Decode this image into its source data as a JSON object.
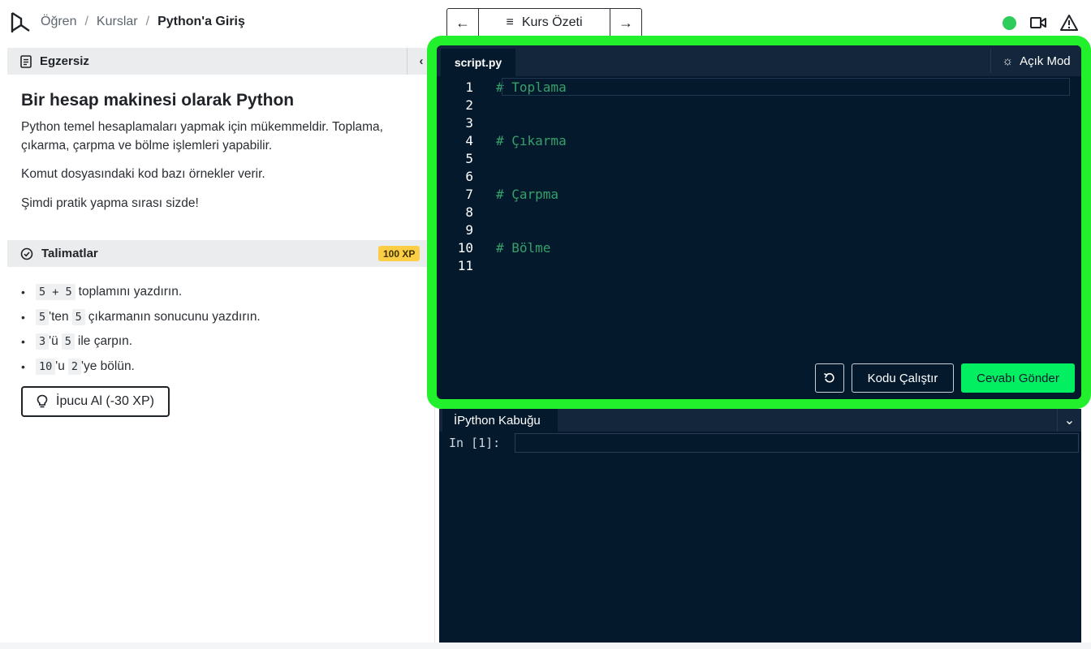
{
  "header": {
    "breadcrumb": [
      "Öğren",
      "Kurslar",
      "Python'a Giriş"
    ],
    "course_nav_label": "Kurs Özeti",
    "status_color": "#2ecc5a"
  },
  "exercise": {
    "section_label": "Egzersiz",
    "title": "Bir hesap makinesi olarak Python",
    "paragraphs": [
      "Python temel hesaplamaları yapmak için mükemmeldir. Toplama, çıkarma, çarpma ve bölme işlemleri yapabilir.",
      "Komut dosyasındaki kod bazı örnekler verir.",
      "Şimdi pratik yapma sırası sizde!"
    ]
  },
  "instructions": {
    "section_label": "Talimatlar",
    "xp_badge": "100 XP",
    "items": [
      {
        "code1": "5 + 5",
        "text1": "toplamını yazdırın.",
        "code2": "",
        "text2": ""
      },
      {
        "code1": "5",
        "text1": "'ten",
        "code2": "5",
        "text2": "çıkarmanın sonucunu yazdırın."
      },
      {
        "code1": "3",
        "text1": "'ü",
        "code2": "5",
        "text2": "ile çarpın."
      },
      {
        "code1": "10",
        "text1": "'u",
        "code2": "2",
        "text2": "'ye bölün."
      }
    ],
    "hint_label": "İpucu Al (-30 XP)"
  },
  "editor": {
    "tab_label": "script.py",
    "mode_label": "Açık Mod",
    "lines": [
      {
        "no": "1",
        "text": "# Toplama"
      },
      {
        "no": "2",
        "text": ""
      },
      {
        "no": "3",
        "text": ""
      },
      {
        "no": "4",
        "text": "# Çıkarma"
      },
      {
        "no": "5",
        "text": ""
      },
      {
        "no": "6",
        "text": ""
      },
      {
        "no": "7",
        "text": "# Çarpma"
      },
      {
        "no": "8",
        "text": ""
      },
      {
        "no": "9",
        "text": ""
      },
      {
        "no": "10",
        "text": "# Bölme"
      },
      {
        "no": "11",
        "text": ""
      }
    ],
    "run_label": "Kodu Çalıştır",
    "submit_label": "Cevabı Gönder",
    "highlight_color": "#22f02c"
  },
  "console": {
    "tab_label": "İPython Kabuğu",
    "prompt": "In [1]:"
  },
  "colors": {
    "editor_bg": "#05192d",
    "submit_green": "#03ef62",
    "xp_yellow": "#fcce45"
  }
}
